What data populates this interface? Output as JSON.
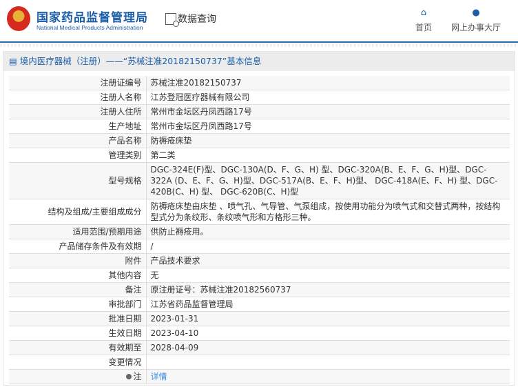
{
  "header": {
    "logo_cn": "国家药品监督管理局",
    "logo_en": "National Medical Products Administration",
    "data_query": "数据查询",
    "nav": [
      {
        "label": "首页",
        "icon": "home-icon"
      },
      {
        "label": "网上办事大厅",
        "icon": "user-icon"
      }
    ]
  },
  "breadcrumb": "境内医疗器械（注册）——“苏械注准20182150737”基本信息",
  "rows": [
    {
      "label": "注册证编号",
      "value": "苏械注准20182150737"
    },
    {
      "label": "注册人名称",
      "value": "江苏登冠医疗器械有限公司"
    },
    {
      "label": "注册人住所",
      "value": "常州市金坛区丹凤西路17号"
    },
    {
      "label": "生产地址",
      "value": "常州市金坛区丹凤西路17号"
    },
    {
      "label": "产品名称",
      "value": "防褥疮床垫"
    },
    {
      "label": "管理类别",
      "value": "第二类"
    },
    {
      "label": "型号规格",
      "value": "DGC-324E(F)型、DGC-130A(D、F、G、H) 型、DGC-320A(B、E、F、G、H)型、DGC-322A (D、E、F、G、H)型、DGC-517A(B、E、F、H)型、 DGC-418A(E、F、H) 型、DGC-420B(C、H) 型、 DGC-620B(C、H)型"
    },
    {
      "label": "结构及组成/主要组成成分",
      "value": "防褥疮床垫由床垫 、喷气孔、气导管、气泵组成，按使用功能分为喷气式和交替式两种，按结构型式分为条纹形、条纹喷气形和方格形三种。"
    },
    {
      "label": "适用范围/预期用途",
      "value": "供防止褥疮用。"
    },
    {
      "label": "产品储存条件及有效期",
      "value": "/"
    },
    {
      "label": "附件",
      "value": "产品技术要求"
    },
    {
      "label": "其他内容",
      "value": "无"
    },
    {
      "label": "备注",
      "value": "原注册证号：苏械注准20182560737"
    },
    {
      "label": "审批部门",
      "value": "江苏省药品监督管理局"
    },
    {
      "label": "批准日期",
      "value": "2023-01-31"
    },
    {
      "label": "生效日期",
      "value": "2023-04-10"
    },
    {
      "label": "有效期至",
      "value": "2028-04-09"
    },
    {
      "label": "变更情况",
      "value": ""
    }
  ],
  "note": {
    "label": "注",
    "link": "详情"
  }
}
